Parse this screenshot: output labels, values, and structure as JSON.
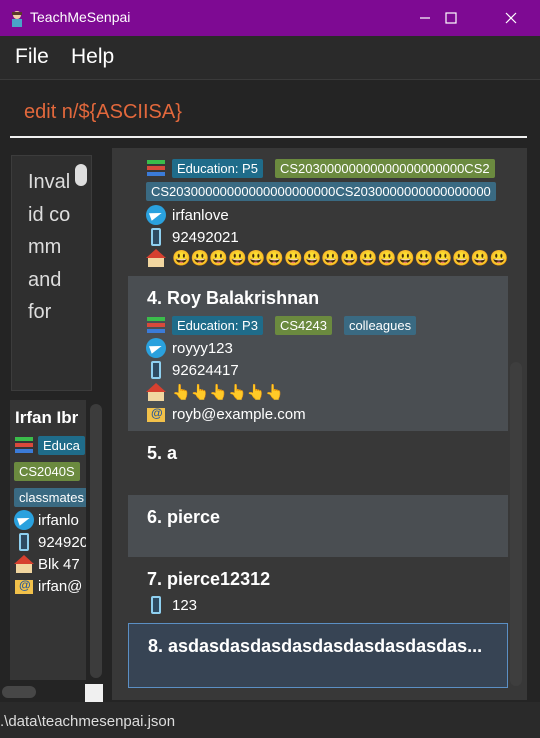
{
  "window": {
    "title": "TeachMeSenpai"
  },
  "menu": {
    "file": "File",
    "help": "Help"
  },
  "command": {
    "value": "edit n/${ASCIISA}"
  },
  "result": {
    "text": "Invalid command for"
  },
  "side_card": {
    "name": "Irfan Ibr",
    "tag_edu": "Educa",
    "tag_mod": "CS2040S",
    "tag_grp": "classmates",
    "telegram": "irfanlo",
    "phone": "924920",
    "address": "Blk 47",
    "email": "irfan@"
  },
  "cards": [
    {
      "tag_edu": "Education: P5",
      "tag_mod": "CS20300000000000000000000CS2",
      "tag_grp": "CS20300000000000000000000CS2030000000000000000",
      "telegram": "irfanlove",
      "phone": "92492021",
      "address": "😃😃😃😃😃😃😃😃😃😃😃😃😃😃😃😃😃😃😃😃"
    },
    {
      "name": "4.  Roy Balakrishnan",
      "tag_edu": "Education: P3",
      "tag_mod": "CS4243",
      "tag_grp": "colleagues",
      "telegram": "royyy123",
      "phone": "92624417",
      "address": "👆👆👆👆👆👆",
      "email": "royb@example.com"
    },
    {
      "name": "5.  a"
    },
    {
      "name": "6.  pierce"
    },
    {
      "name": "7.  pierce12312",
      "phone": "123"
    },
    {
      "name": "8.  asdasdasdasdasdasdasdasdasdas..."
    }
  ],
  "status": {
    "path": ".\\data\\teachmesenpai.json"
  },
  "colors": {
    "titlebar": "#7e0a93",
    "command_text": "#e2683c",
    "selected_border": "#5b8fc4"
  }
}
